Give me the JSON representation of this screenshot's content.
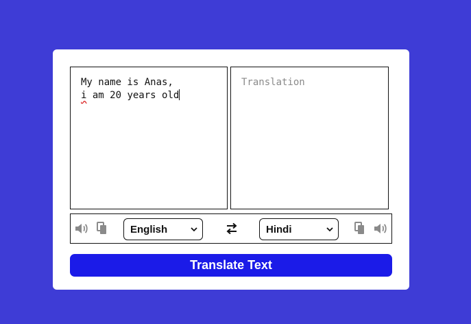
{
  "source": {
    "line1": "My name is Anas,",
    "line2_first": "i",
    "line2_rest": " am 20 years old"
  },
  "target": {
    "placeholder": "Translation"
  },
  "controls": {
    "from_language": "English",
    "to_language": "Hindi",
    "icons": {
      "left_speak": "speaker-icon",
      "left_copy": "copy-icon",
      "swap": "swap-icon",
      "right_copy": "copy-icon",
      "right_speak": "speaker-icon"
    }
  },
  "translate_button": {
    "label": "Translate Text"
  },
  "colors": {
    "background": "#3e3cd6",
    "card": "#ffffff",
    "button": "#1b1be8",
    "icon": "#8a8a8a"
  }
}
